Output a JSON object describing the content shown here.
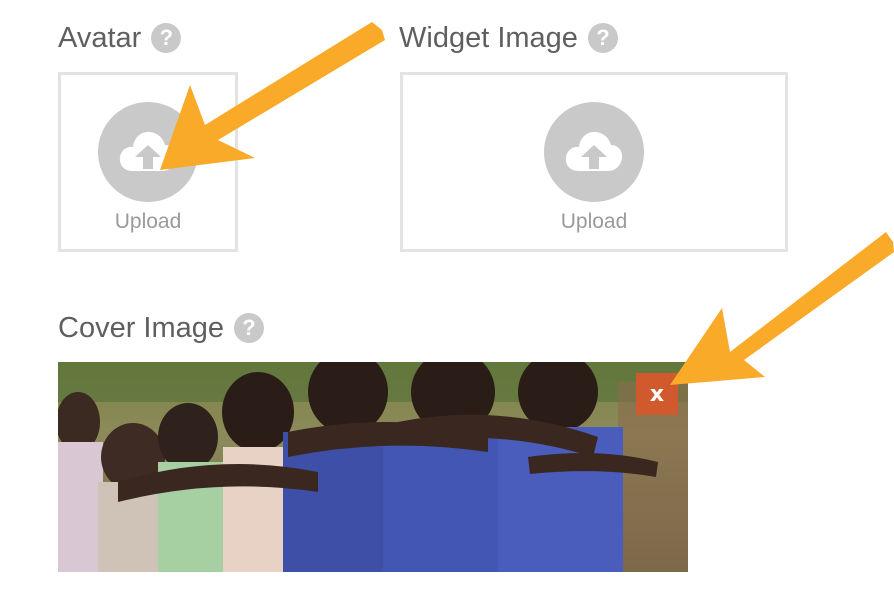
{
  "avatar": {
    "label": "Avatar",
    "help_icon": "question-circle-icon",
    "upload_label": "Upload",
    "upload_icon": "cloud-upload-icon"
  },
  "widget_image": {
    "label": "Widget Image",
    "help_icon": "question-circle-icon",
    "upload_label": "Upload",
    "upload_icon": "cloud-upload-icon"
  },
  "cover_image": {
    "label": "Cover Image",
    "help_icon": "question-circle-icon",
    "remove_label": "x"
  },
  "help_glyph": "?",
  "colors": {
    "label_text": "#5f5f5f",
    "help_icon_bg": "#c9c9c9",
    "upload_border": "#e3e3e3",
    "upload_icon_bg": "#c9c9c9",
    "upload_text": "#9a9a9a",
    "remove_button_bg": "#d05a2e",
    "annotation_arrow": "#f8aa28"
  }
}
